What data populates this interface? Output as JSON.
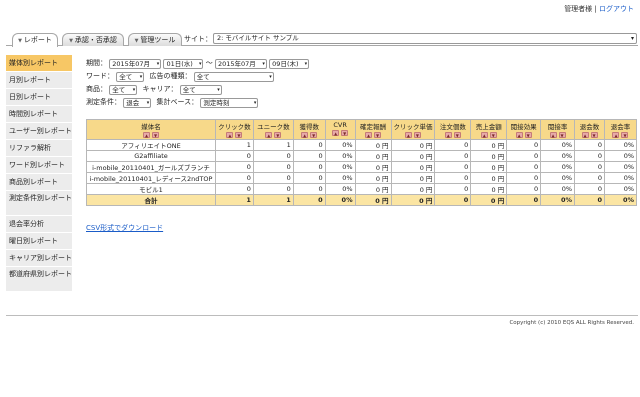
{
  "header": {
    "user": "管理者様",
    "separator": " | ",
    "logout": "ログアウト"
  },
  "tabs": [
    {
      "label": "レポート",
      "active": true
    },
    {
      "label": "承認・否承認",
      "active": false
    },
    {
      "label": "管理ツール",
      "active": false
    }
  ],
  "site": {
    "label": "サイト：",
    "value": "2: モバイルサイト サンプル"
  },
  "sidebar": {
    "items": [
      {
        "label": "媒体別レポート",
        "active": true
      },
      {
        "label": "月別レポート"
      },
      {
        "label": "日別レポート"
      },
      {
        "label": "時間別レポート"
      },
      {
        "label": "ユーザー別レポート"
      },
      {
        "label": "リファラ解析"
      },
      {
        "label": "ワード別レポート"
      },
      {
        "label": "商品別レポート"
      },
      {
        "label": "測定条件別レポート"
      },
      {
        "label": "退会率分析"
      },
      {
        "label": "曜日別レポート"
      },
      {
        "label": "キャリア別レポート"
      },
      {
        "label": "都道府県別レポート"
      }
    ]
  },
  "filters": {
    "period_label": "期間：",
    "start_month": "2015年07月",
    "start_day": "01日(水)",
    "range_sep": "～",
    "end_month": "2015年07月",
    "end_day": "09日(木)",
    "word_label": "ワード：",
    "word_value": "全て",
    "ad_type_label": "広告の種類：",
    "ad_type_value": "全て",
    "product_label": "商品：",
    "product_value": "全て",
    "carrier_label": "キャリア：",
    "carrier_value": "全て",
    "condition_label": "測定条件：",
    "condition_value": "退会",
    "base_label": "集計ベース：",
    "base_value": "測定時刻"
  },
  "table": {
    "columns": [
      "媒体名",
      "クリック数",
      "ユニーク数",
      "獲得数",
      "CVR",
      "確定報酬",
      "クリック単価",
      "注文個数",
      "売上金額",
      "閲接効果",
      "閲接率",
      "退会数",
      "退会率"
    ],
    "rows": [
      [
        "アフィリエイトONE",
        "1",
        "1",
        "0",
        "0%",
        "0 円",
        "0 円",
        "0",
        "0 円",
        "0",
        "0%",
        "0",
        "0%"
      ],
      [
        "G2affiliate",
        "0",
        "0",
        "0",
        "0%",
        "0 円",
        "0 円",
        "0",
        "0 円",
        "0",
        "0%",
        "0",
        "0%"
      ],
      [
        "i-mobile_20110401_ガールズブランチ",
        "0",
        "0",
        "0",
        "0%",
        "0 円",
        "0 円",
        "0",
        "0 円",
        "0",
        "0%",
        "0",
        "0%"
      ],
      [
        "i-mobile_20110401_レディース2ndTOP",
        "0",
        "0",
        "0",
        "0%",
        "0 円",
        "0 円",
        "0",
        "0 円",
        "0",
        "0%",
        "0",
        "0%"
      ],
      [
        "モビル1",
        "0",
        "0",
        "0",
        "0%",
        "0 円",
        "0 円",
        "0",
        "0 円",
        "0",
        "0%",
        "0",
        "0%"
      ]
    ],
    "total": [
      "合計",
      "1",
      "1",
      "0",
      "0%",
      "0 円",
      "0 円",
      "0",
      "0 円",
      "0",
      "0%",
      "0",
      "0%"
    ]
  },
  "csv_link": "CSV形式でダウンロード",
  "footer": {
    "copyright": "Copyright (c) 2010 EQS ALL Rights Reserved."
  },
  "colors": {
    "accent_tab": "#f7c765",
    "table_header": "#f7d98a",
    "total_row": "#fbe5a3",
    "link": "#1a5cc8"
  }
}
